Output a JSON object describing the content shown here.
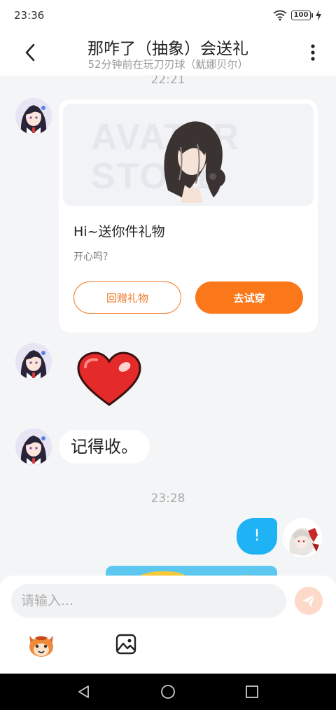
{
  "status_bar": {
    "time": "23:36",
    "battery": "100",
    "icons": [
      "wifi-icon",
      "battery-icon",
      "charging-icon"
    ]
  },
  "header": {
    "title": "那咋了（抽象）会送礼",
    "subtitle": "52分钟前在玩刀刃球（魷娜贝尔）",
    "back_icon": "chevron-left-icon",
    "more_icon": "more-vertical-icon"
  },
  "messages": {
    "time_1": "22:21",
    "gift_card": {
      "watermark": "AVATAR STORE",
      "title": "Hi~送你件礼物",
      "subtitle": "开心吗？",
      "return_gift_label": "回赠礼物",
      "try_on_label": "去试穿",
      "accent_color": "#fa7819"
    },
    "sticker": "heart-sticker",
    "text_message": "记得收。",
    "time_2": "23:28",
    "outgoing_message": "!"
  },
  "input_bar": {
    "placeholder": "请输入...",
    "send_icon": "send-icon",
    "emoji_icon": "emoji-mascot-icon",
    "image_icon": "image-icon"
  },
  "nav_bar": {
    "buttons": [
      "back-triangle-icon",
      "home-circle-icon",
      "recents-square-icon"
    ]
  }
}
